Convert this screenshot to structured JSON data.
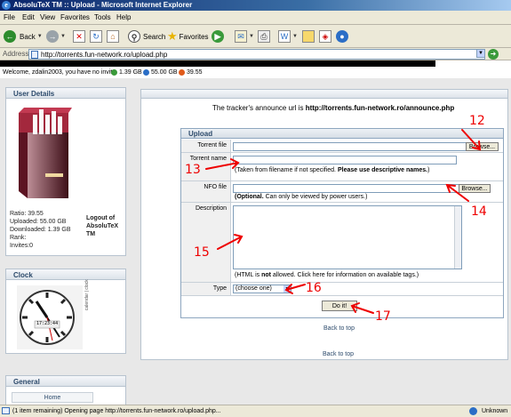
{
  "window": {
    "title": "AbsoluTeX TM :: Upload - Microsoft Internet Explorer"
  },
  "menu": [
    "File",
    "Edit",
    "View",
    "Favorites",
    "Tools",
    "Help"
  ],
  "toolbar": {
    "back_label": "Back",
    "search_label": "Search",
    "favorites_label": "Favorites"
  },
  "address": {
    "label": "Address",
    "url": "http://torrents.fun-network.ro/upload.php"
  },
  "welcome": {
    "text": "Welcome, zdalin2003, you have no invite",
    "uploaded": "1.39 GB",
    "downloaded": "55.00 GB",
    "ratio": "39.55"
  },
  "user_details": {
    "header": "User Details",
    "ratio": "Ratio: 39.55",
    "uploaded": "Uploaded: 55.00 GB",
    "downloaded": "Downloaded: 1.39 GB",
    "rank": "Rank:",
    "invites": "Invites:0",
    "logout_line1": "Logout of",
    "logout_line2": "AbsoluTeX",
    "logout_line3": "TM"
  },
  "clock": {
    "header": "Clock",
    "time": "17:23:44",
    "side_text": "calendar | clock"
  },
  "general": {
    "header": "General",
    "items": [
      "Home"
    ]
  },
  "main": {
    "announce_prefix": "The tracker's announce url is ",
    "announce_url": "http://torrents.fun-network.ro/announce.php",
    "upload_header": "Upload",
    "torrent_file_label": "Torrent file",
    "browse_label": "Browse...",
    "torrent_name_label": "Torrent name",
    "name_note_plain": "(Taken from filename if not specified. ",
    "name_note_bold": "Please use descriptive names.",
    "name_note_end": ")",
    "nfo_label": "NFO file",
    "nfo_note_bold": "(Optional.",
    "nfo_note_rest": " Can only be viewed by power users.)",
    "description_label": "Description",
    "html_note_1": "(HTML is ",
    "html_note_bold": "not",
    "html_note_2": " allowed. Click here for information on available tags.)",
    "type_label": "Type",
    "type_selected": "(choose one)",
    "submit_label": "Do it!",
    "back_to_top_1": "Back to top",
    "back_to_top_2": "Back to top"
  },
  "annotations": [
    "12",
    "13",
    "14",
    "15",
    "16",
    "17"
  ],
  "status": {
    "text": "(1 item remaining) Opening page http://torrents.fun-network.ro/upload.php...",
    "zone": "Unknown"
  }
}
